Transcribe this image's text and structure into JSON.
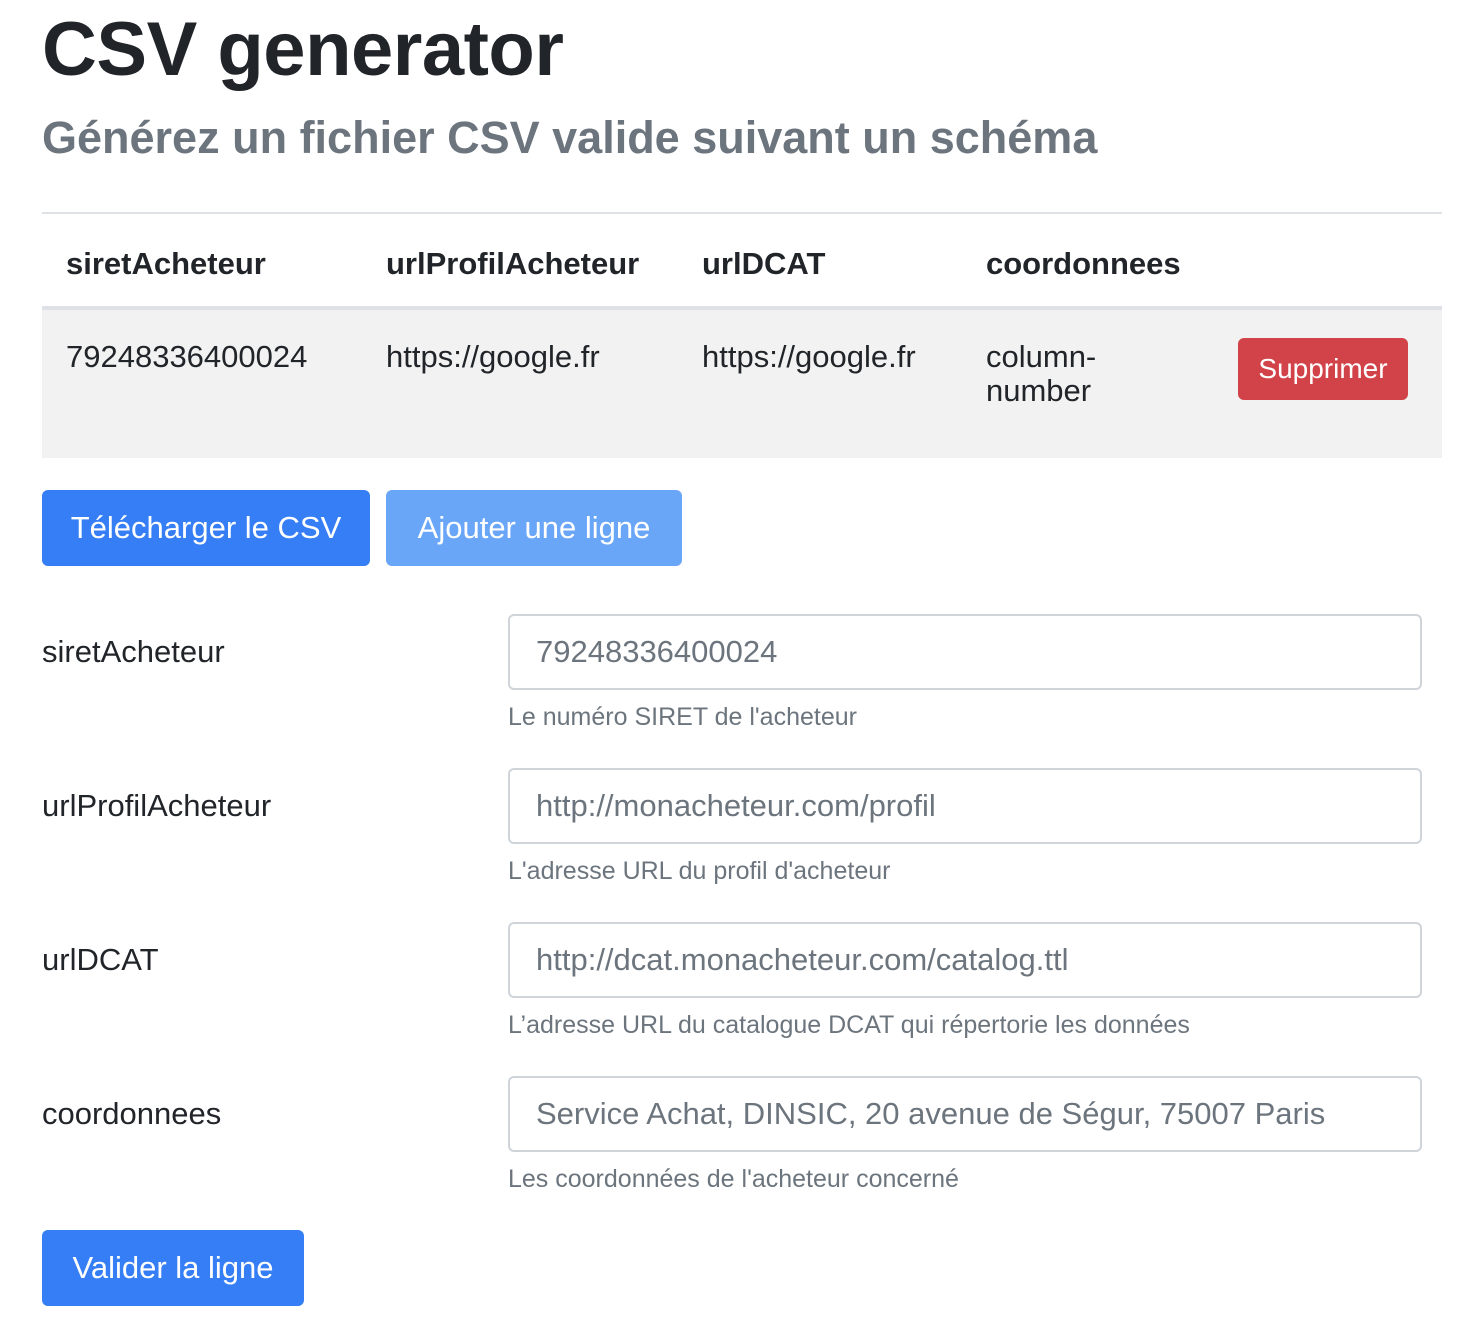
{
  "page": {
    "title": "CSV generator",
    "subtitle": "Générez un fichier CSV valide suivant un schéma"
  },
  "table": {
    "headers": [
      "siretAcheteur",
      "urlProfilAcheteur",
      "urlDCAT",
      "coordonnees"
    ],
    "rows": [
      {
        "cells": [
          "79248336400024",
          "https://google.fr",
          "https://google.fr",
          "column-number"
        ],
        "delete_label": "Supprimer"
      }
    ]
  },
  "actions": {
    "download_label": "Télécharger le CSV",
    "add_row_label": "Ajouter une ligne"
  },
  "form": {
    "fields": [
      {
        "label": "siretAcheteur",
        "value": "",
        "placeholder": "79248336400024",
        "help": "Le numéro SIRET de l'acheteur"
      },
      {
        "label": "urlProfilAcheteur",
        "value": "",
        "placeholder": "http://monacheteur.com/profil",
        "help": "L'adresse URL du profil d'acheteur"
      },
      {
        "label": "urlDCAT",
        "value": "",
        "placeholder": "http://dcat.monacheteur.com/catalog.ttl",
        "help": "L’adresse URL du catalogue DCAT qui répertorie les données"
      },
      {
        "label": "coordonnees",
        "value": "",
        "placeholder": "Service Achat, DINSIC, 20 avenue de Ségur, 75007 Paris",
        "help": "Les coordonnées de l'acheteur concerné"
      }
    ],
    "submit_label": "Valider la ligne"
  },
  "colors": {
    "primary": "#357ef5",
    "primary_disabled": "#6aa6f8",
    "danger": "#d24349",
    "muted": "#6c757d",
    "row_background": "#f2f2f2"
  }
}
